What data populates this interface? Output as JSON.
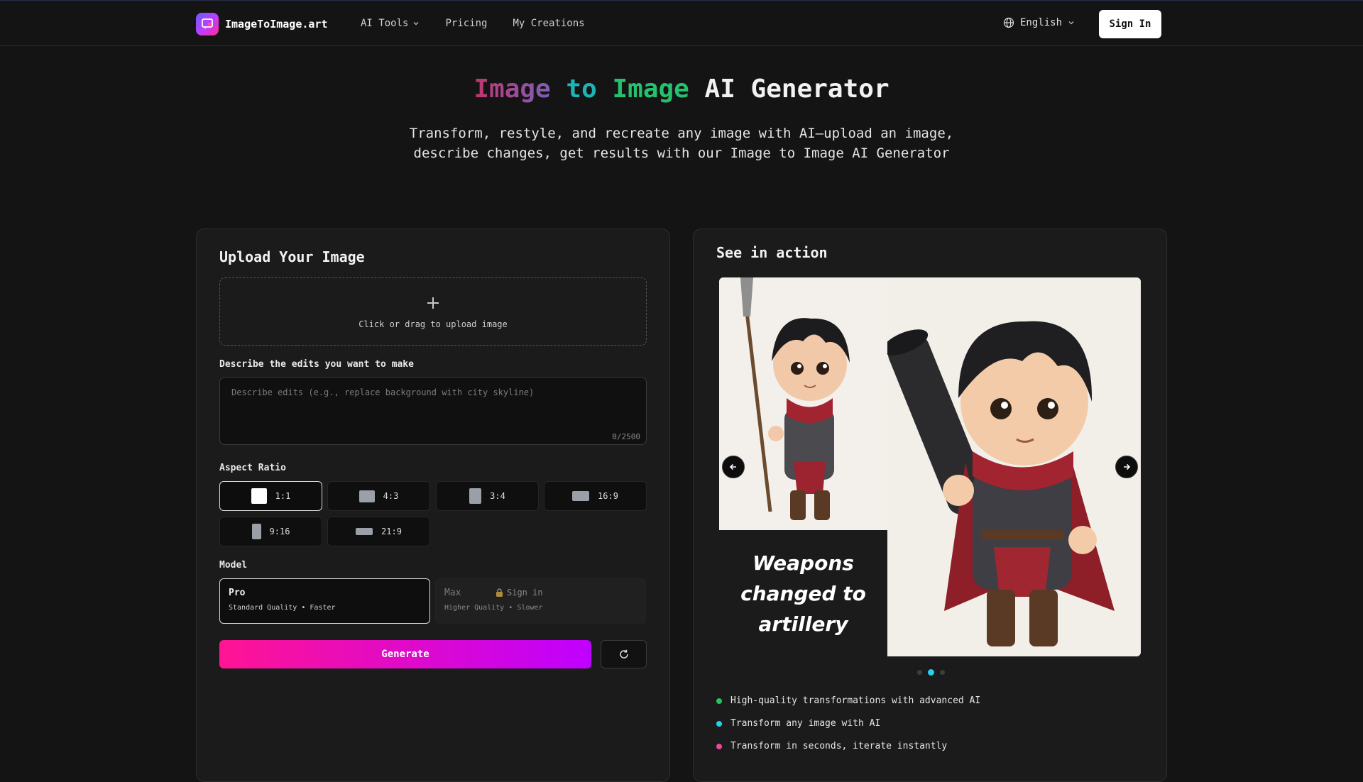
{
  "brand": {
    "name": "ImageToImage.art",
    "logo_icon": "chat-image-icon"
  },
  "nav": {
    "links": [
      {
        "label": "AI Tools",
        "has_dropdown": true
      },
      {
        "label": "Pricing",
        "has_dropdown": false
      },
      {
        "label": "My Creations",
        "has_dropdown": false
      }
    ],
    "language": "English",
    "sign_in": "Sign In"
  },
  "hero": {
    "title_part1": "Image",
    "title_part2": "to",
    "title_part3": "Image",
    "title_part4": "AI Generator",
    "subtitle": "Transform, restyle, and recreate any image with AI—upload an image, describe changes, get results with our Image to Image AI Generator"
  },
  "upload_panel": {
    "title": "Upload Your Image",
    "upload_hint": "Click or drag to upload image",
    "edits_label": "Describe the edits you want to make",
    "edits_placeholder": "Describe edits (e.g., replace background with city skyline)",
    "char_counter": "0/2500",
    "aspect_label": "Aspect Ratio",
    "aspect_ratios": [
      {
        "label": "1:1",
        "selected": true
      },
      {
        "label": "4:3",
        "selected": false
      },
      {
        "label": "3:4",
        "selected": false
      },
      {
        "label": "16:9",
        "selected": false
      },
      {
        "label": "9:16",
        "selected": false
      },
      {
        "label": "21:9",
        "selected": false
      }
    ],
    "model_label": "Model",
    "models": [
      {
        "name": "Pro",
        "desc": "Standard Quality • Faster",
        "selected": true,
        "locked": false
      },
      {
        "name": "Max",
        "desc": "Higher Quality • Slower",
        "selected": false,
        "locked": true,
        "lock_text": "Sign in"
      }
    ],
    "generate_label": "Generate"
  },
  "action_panel": {
    "title": "See in action",
    "caption": "Weapons changed to artillery",
    "carousel": {
      "slide_count": 3,
      "active_index": 1
    },
    "features": [
      {
        "text": "High-quality transformations with advanced AI",
        "color": "#22c55e"
      },
      {
        "text": "Transform any image with AI",
        "color": "#22d3ee"
      },
      {
        "text": "Transform in seconds, iterate instantly",
        "color": "#ec4899"
      }
    ]
  },
  "colors": {
    "background": "#141414",
    "panel": "#1b1b1b",
    "generate_gradient_start": "#ff1493",
    "generate_gradient_end": "#c000ff"
  }
}
